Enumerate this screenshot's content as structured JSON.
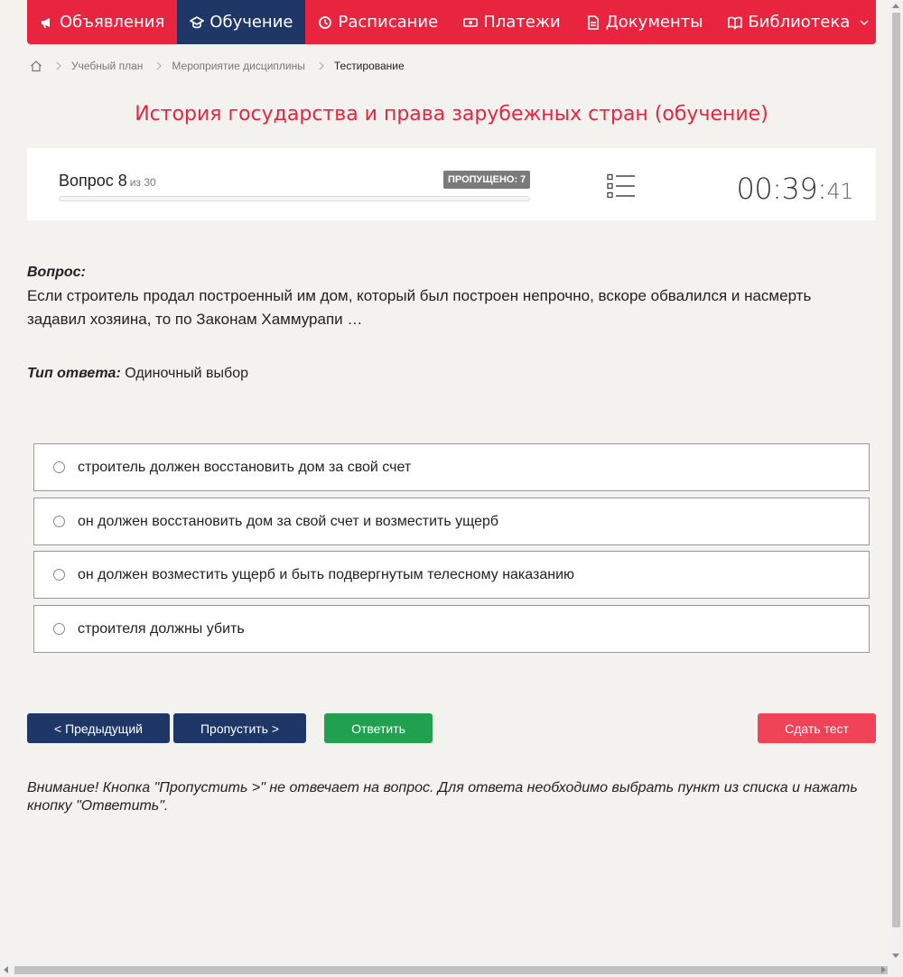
{
  "nav": {
    "items": [
      {
        "label": "Объявления",
        "icon": "megaphone-icon"
      },
      {
        "label": "Обучение",
        "icon": "graduation-cap-icon",
        "active": true
      },
      {
        "label": "Расписание",
        "icon": "clock-icon"
      },
      {
        "label": "Платежи",
        "icon": "money-icon"
      },
      {
        "label": "Документы",
        "icon": "document-icon"
      },
      {
        "label": "Библиотека",
        "icon": "book-icon",
        "dropdown": true
      }
    ],
    "colors": {
      "bar": "#e8243f",
      "active": "#1e3767"
    }
  },
  "breadcrumb": {
    "home_icon": "home-icon",
    "items": [
      "Учебный план",
      "Мероприятие дисциплины",
      "Тестирование"
    ]
  },
  "page_title": "История государства и права зарубежных стран (обучение)",
  "progress": {
    "question_label": "Вопрос 8",
    "of_label": "из 30",
    "current": 8,
    "total": 30,
    "skipped_label": "ПРОПУЩЕНО: 7",
    "fill_fraction": 0,
    "timer_main": "00:39:",
    "timer_seconds": "41"
  },
  "question": {
    "label": "Вопрос:",
    "text": "Если строитель продал построенный им дом, который был построен непрочно, вскоре обвалился и насмерть задавил хозяина, то по Законам Хаммурапи …",
    "answer_type_label": "Тип ответа:",
    "answer_type_value": "Одиночный выбор"
  },
  "options": [
    "строитель должен восстановить дом за свой счет",
    "он должен восстановить дом за свой счет и возместить ущерб",
    "он должен возместить ущерб и быть подвергнутым телесному наказанию",
    "строителя должны убить"
  ],
  "buttons": {
    "prev": "< Предыдущий",
    "skip": "Пропустить >",
    "answer": "Ответить",
    "submit": "Сдать тест"
  },
  "warning": "Внимание! Кнопка \"Пропустить >\" не отвечает на вопрос. Для ответа необходимо выбрать пункт из списка и нажать кнопку \"Ответить\"."
}
